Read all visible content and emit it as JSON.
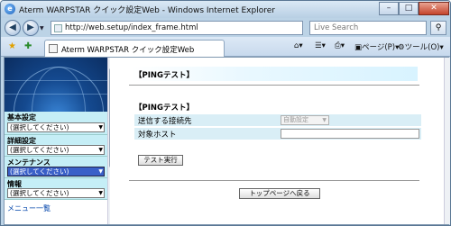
{
  "window": {
    "title": "Aterm WARPSTAR クイック設定Web - Windows Internet Explorer",
    "minimize": "–",
    "maximize": "□",
    "close": "✕"
  },
  "addressbar": {
    "url": "http://web.setup/index_frame.html",
    "search_placeholder": "Live Search",
    "back_icon": "back-arrow-icon",
    "forward_icon": "forward-arrow-icon"
  },
  "tabbar": {
    "tab_title": "Aterm WARPSTAR クイック設定Web",
    "page_menu": "ページ(P)",
    "tools_menu": "ツール(O)"
  },
  "sidebar": {
    "sections": [
      {
        "heading": "基本設定",
        "selected": "(選択してください)",
        "highlighted": false
      },
      {
        "heading": "詳細設定",
        "selected": "(選択してください)",
        "highlighted": false
      },
      {
        "heading": "メンテナンス",
        "selected": "(選択してください)",
        "highlighted": true
      },
      {
        "heading": "情報",
        "selected": "(選択してください)",
        "highlighted": false
      }
    ],
    "menu_list": "メニュー一覧"
  },
  "main": {
    "header": "【PINGテスト】",
    "section_title": "【PINGテスト】",
    "rows": [
      {
        "label": "送信する接続先",
        "value": "自動設定"
      },
      {
        "label": "対象ホスト",
        "value": ""
      }
    ],
    "run_button": "テスト実行",
    "top_button": "トップページへ戻る"
  },
  "colors": {
    "menu_bg": "#c5eef6",
    "form_row_bg": "#d9eef6",
    "highlight": "#3a60c8"
  }
}
